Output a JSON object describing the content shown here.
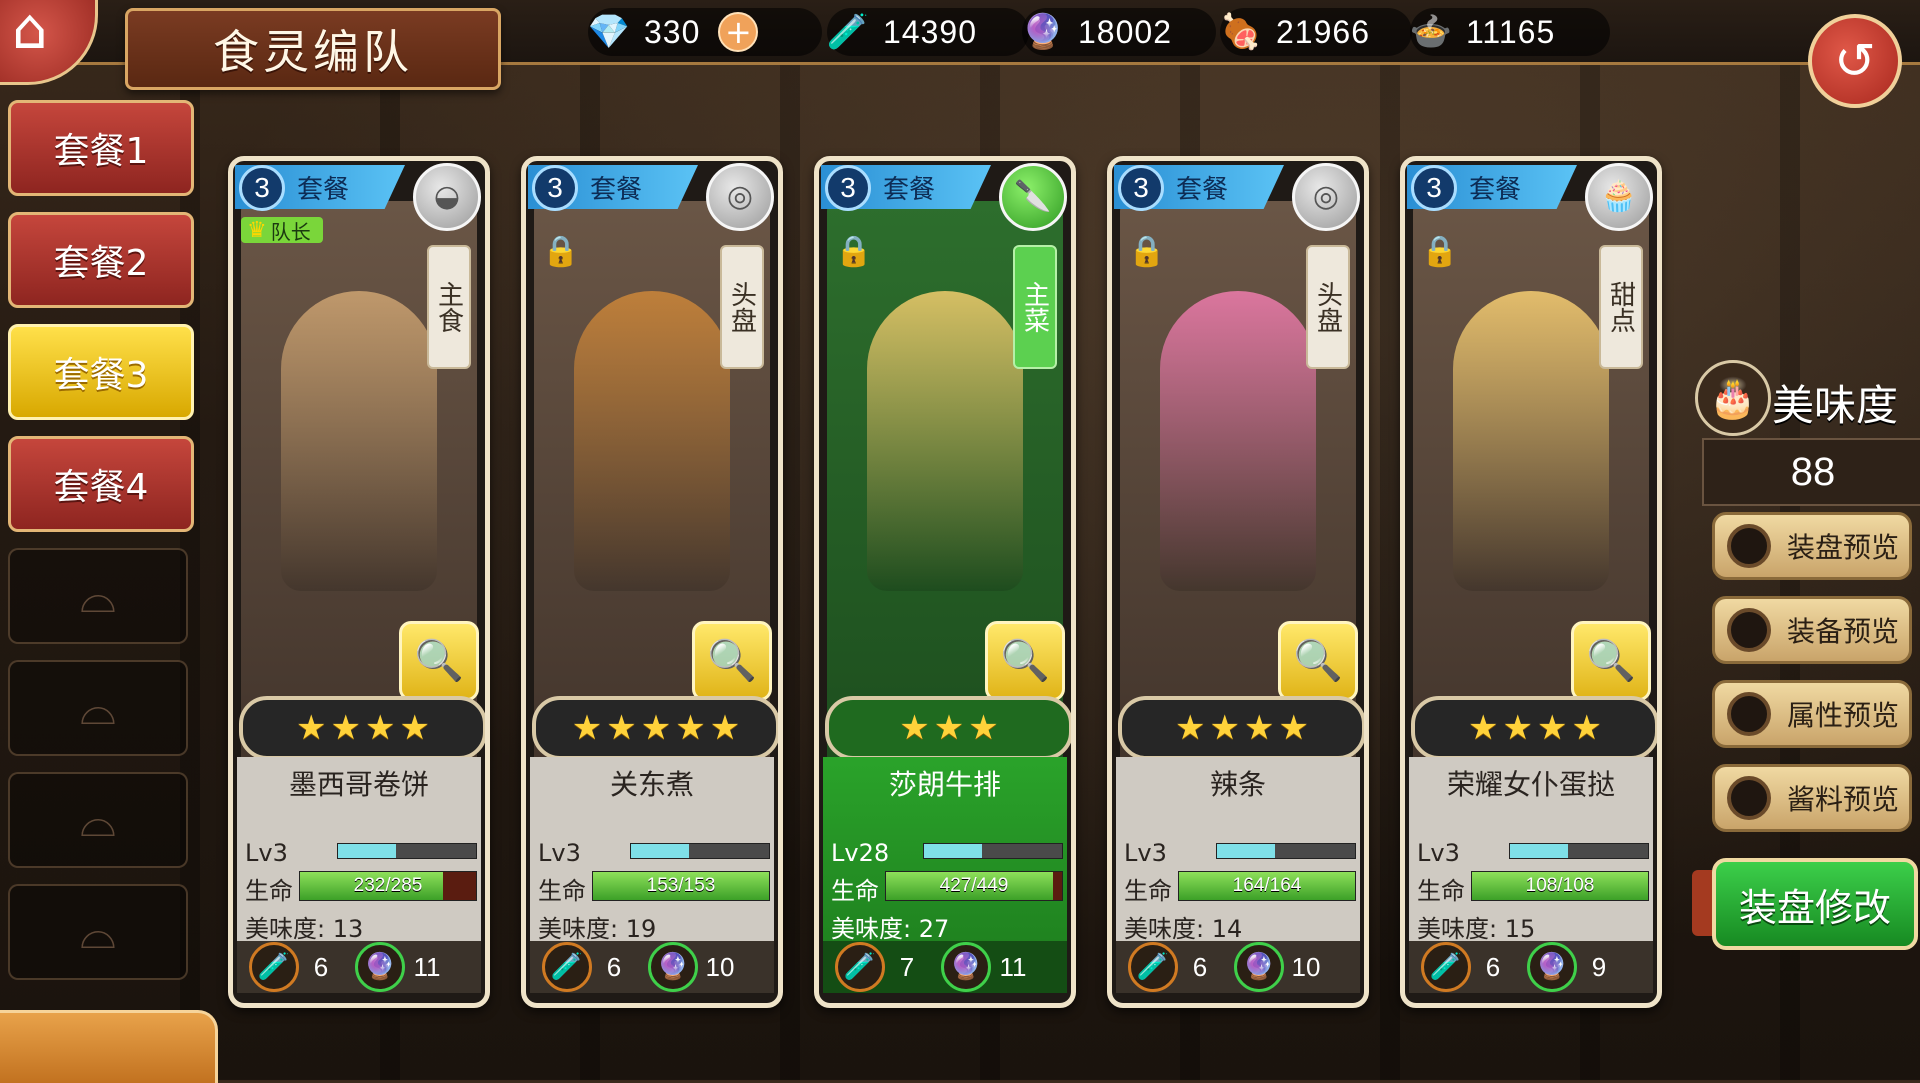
{
  "header": {
    "title": "食灵编队"
  },
  "resources": [
    {
      "icon": "diamond-icon",
      "glyph": "💎",
      "value": "330",
      "has_plus": true
    },
    {
      "icon": "oil-bottle-icon",
      "glyph": "🧪",
      "value": "14390"
    },
    {
      "icon": "purple-gem-icon",
      "glyph": "🔮",
      "value": "18002"
    },
    {
      "icon": "meat-icon",
      "glyph": "🍖",
      "value": "21966"
    },
    {
      "icon": "food-bowl-icon",
      "glyph": "🍲",
      "value": "11165"
    }
  ],
  "plus_glyph": "+",
  "back_glyph": "↺",
  "home_glyph": "⌂",
  "menu": {
    "items": [
      {
        "label": "套餐1",
        "active": false
      },
      {
        "label": "套餐2",
        "active": false
      },
      {
        "label": "套餐3",
        "active": true
      },
      {
        "label": "套餐4",
        "active": false
      }
    ],
    "empty_slots": 4
  },
  "team_label": "套餐",
  "leader_label": "队长",
  "cards": [
    {
      "team": "3",
      "category": "主食",
      "type_icon": "bowl-icon",
      "type_glyph": "◒",
      "leader": true,
      "locked": false,
      "highlighted": false,
      "stars": 4,
      "name": "墨西哥卷饼",
      "level": "Lv3",
      "level_progress": 0.42,
      "hp_label": "生命",
      "hp": "232/285",
      "hp_ratio": 0.814,
      "taste": "美味度: 13",
      "oil_cost": "6",
      "gem_cost": "11",
      "accent": "#c9a070"
    },
    {
      "team": "3",
      "category": "头盘",
      "type_icon": "plate-icon",
      "type_glyph": "◎",
      "leader": false,
      "locked": true,
      "highlighted": false,
      "stars": 5,
      "name": "关东煮",
      "level": "Lv3",
      "level_progress": 0.42,
      "hp_label": "生命",
      "hp": "153/153",
      "hp_ratio": 1.0,
      "taste": "美味度: 19",
      "oil_cost": "6",
      "gem_cost": "10",
      "accent": "#c8843a"
    },
    {
      "team": "3",
      "category": "主菜",
      "type_icon": "knife-icon",
      "type_glyph": "🔪",
      "leader": false,
      "locked": true,
      "highlighted": true,
      "stars": 3,
      "name": "莎朗牛排",
      "level": "Lv28",
      "level_progress": 0.42,
      "hp_label": "生命",
      "hp": "427/449",
      "hp_ratio": 0.951,
      "taste": "美味度: 27",
      "oil_cost": "7",
      "gem_cost": "11",
      "accent": "#e8c86a"
    },
    {
      "team": "3",
      "category": "头盘",
      "type_icon": "plate-icon",
      "type_glyph": "◎",
      "leader": false,
      "locked": true,
      "highlighted": false,
      "stars": 4,
      "name": "辣条",
      "level": "Lv3",
      "level_progress": 0.42,
      "hp_label": "生命",
      "hp": "164/164",
      "hp_ratio": 1.0,
      "taste": "美味度: 14",
      "oil_cost": "6",
      "gem_cost": "10",
      "accent": "#e87aa8"
    },
    {
      "team": "3",
      "category": "甜点",
      "type_icon": "cake-icon",
      "type_glyph": "🧁",
      "leader": false,
      "locked": true,
      "highlighted": false,
      "stars": 4,
      "name": "荣耀女仆蛋挞",
      "level": "Lv3",
      "level_progress": 0.42,
      "hp_label": "生命",
      "hp": "108/108",
      "hp_ratio": 1.0,
      "taste": "美味度: 15",
      "oil_cost": "6",
      "gem_cost": "9",
      "accent": "#f0c870"
    }
  ],
  "side_panel": {
    "taste_label": "美味度",
    "taste_value": "88",
    "preview_buttons": [
      "装盘预览",
      "装备预览",
      "属性预览",
      "酱料预览"
    ],
    "modify_button": "装盘修改"
  },
  "colors": {
    "accent_gold": "#d9a663",
    "active_tab": "#ffe04a",
    "hp_green": "#3ca028",
    "level_cyan": "#7fe0e8"
  }
}
